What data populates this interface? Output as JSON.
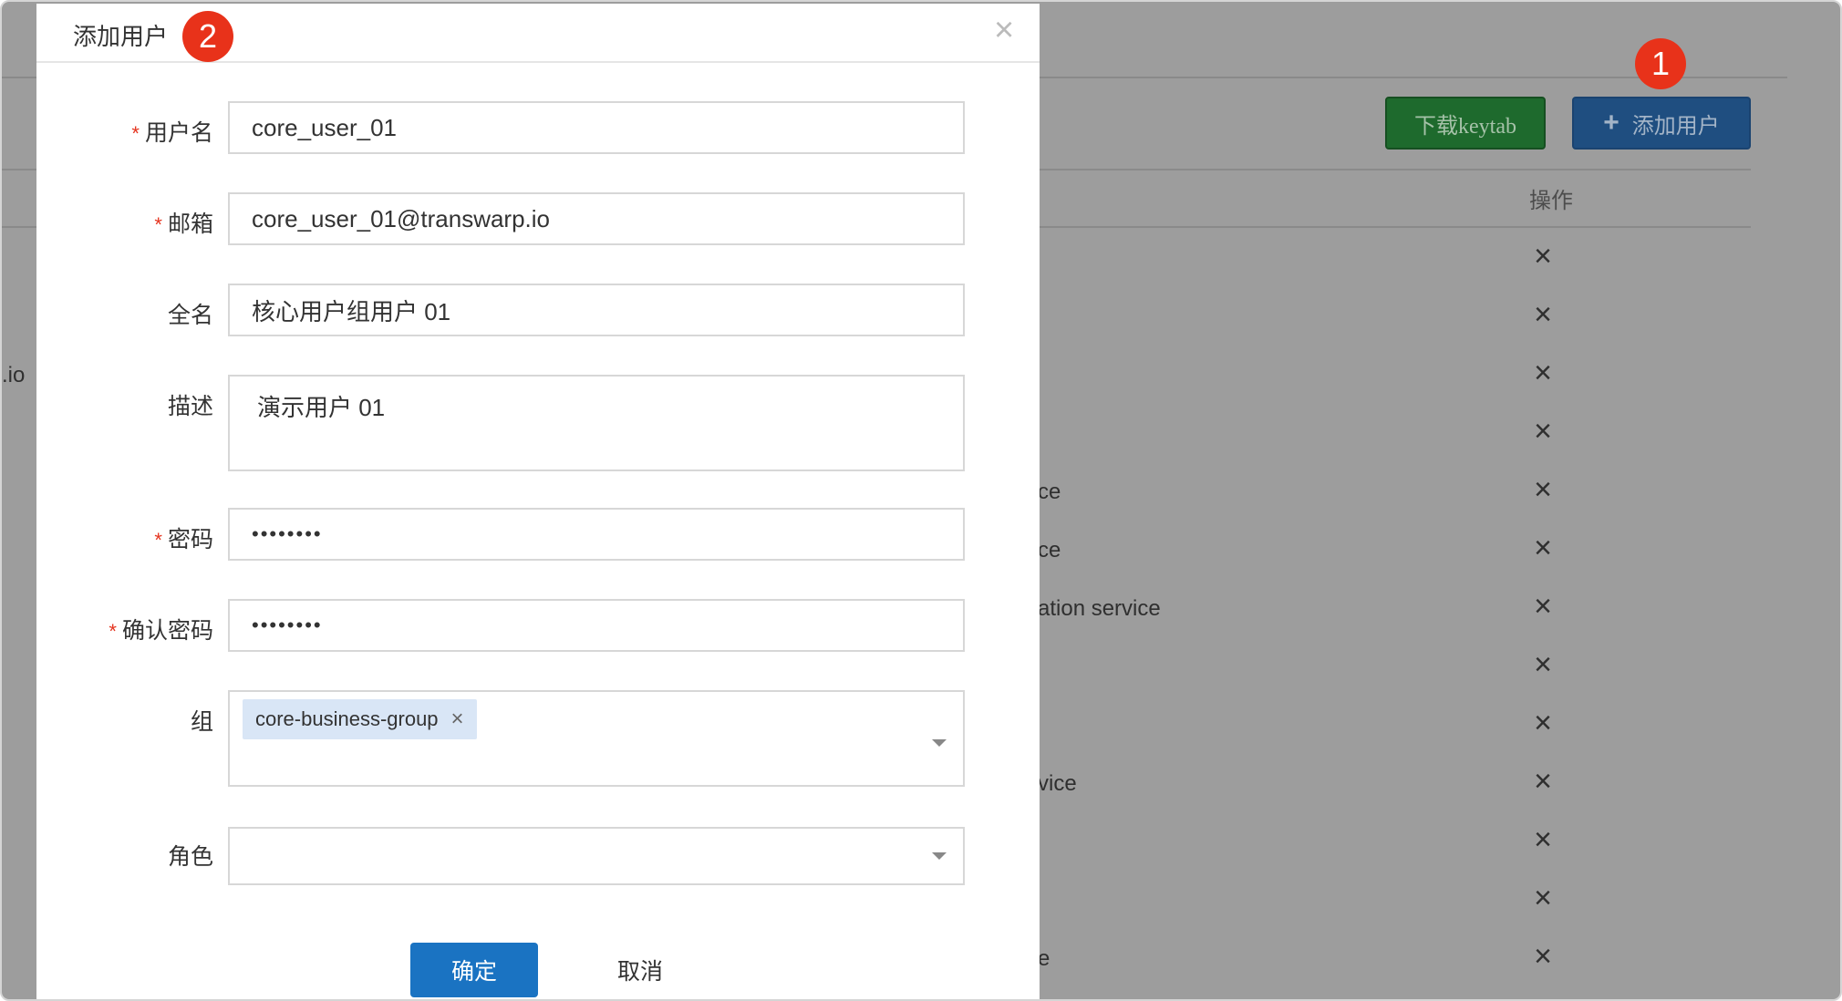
{
  "background": {
    "download_keytab_label": "下载keytab",
    "add_user_label": "添加用户",
    "add_user_icon": "plus-icon",
    "step1_badge": "1",
    "ops_column_header": "操作",
    "row_delete_icon": "×",
    "row_count": 13,
    "partial_texts": {
      "io": ".io",
      "ce1": "ce",
      "ce2": "ce",
      "ation_service": "ation service",
      "vice": "vice",
      "e": "e"
    }
  },
  "modal": {
    "title": "添加用户",
    "step2_badge": "2",
    "close_icon": "×",
    "required_mark": "*",
    "fields": {
      "username": {
        "label": "用户名",
        "value": "core_user_01"
      },
      "email": {
        "label": "邮箱",
        "value": "core_user_01@transwarp.io"
      },
      "fullname": {
        "label": "全名",
        "value": "核心用户组用户 01"
      },
      "description": {
        "label": "描述",
        "value": "演示用户 01"
      },
      "password": {
        "label": "密码",
        "value": "••••••••"
      },
      "confirm_password": {
        "label": "确认密码",
        "value": "••••••••"
      },
      "group": {
        "label": "组",
        "tag": "core-business-group",
        "tag_remove": "×"
      },
      "role": {
        "label": "角色",
        "value": ""
      }
    },
    "ok_label": "确定",
    "cancel_label": "取消"
  },
  "colors": {
    "overlay": "#9d9d9d",
    "primary": "#1a73c2",
    "success_dimmed": "#1e6a2d",
    "badge": "#e8321a",
    "required": "#e5341f",
    "tag_bg": "#d9e6f6"
  }
}
